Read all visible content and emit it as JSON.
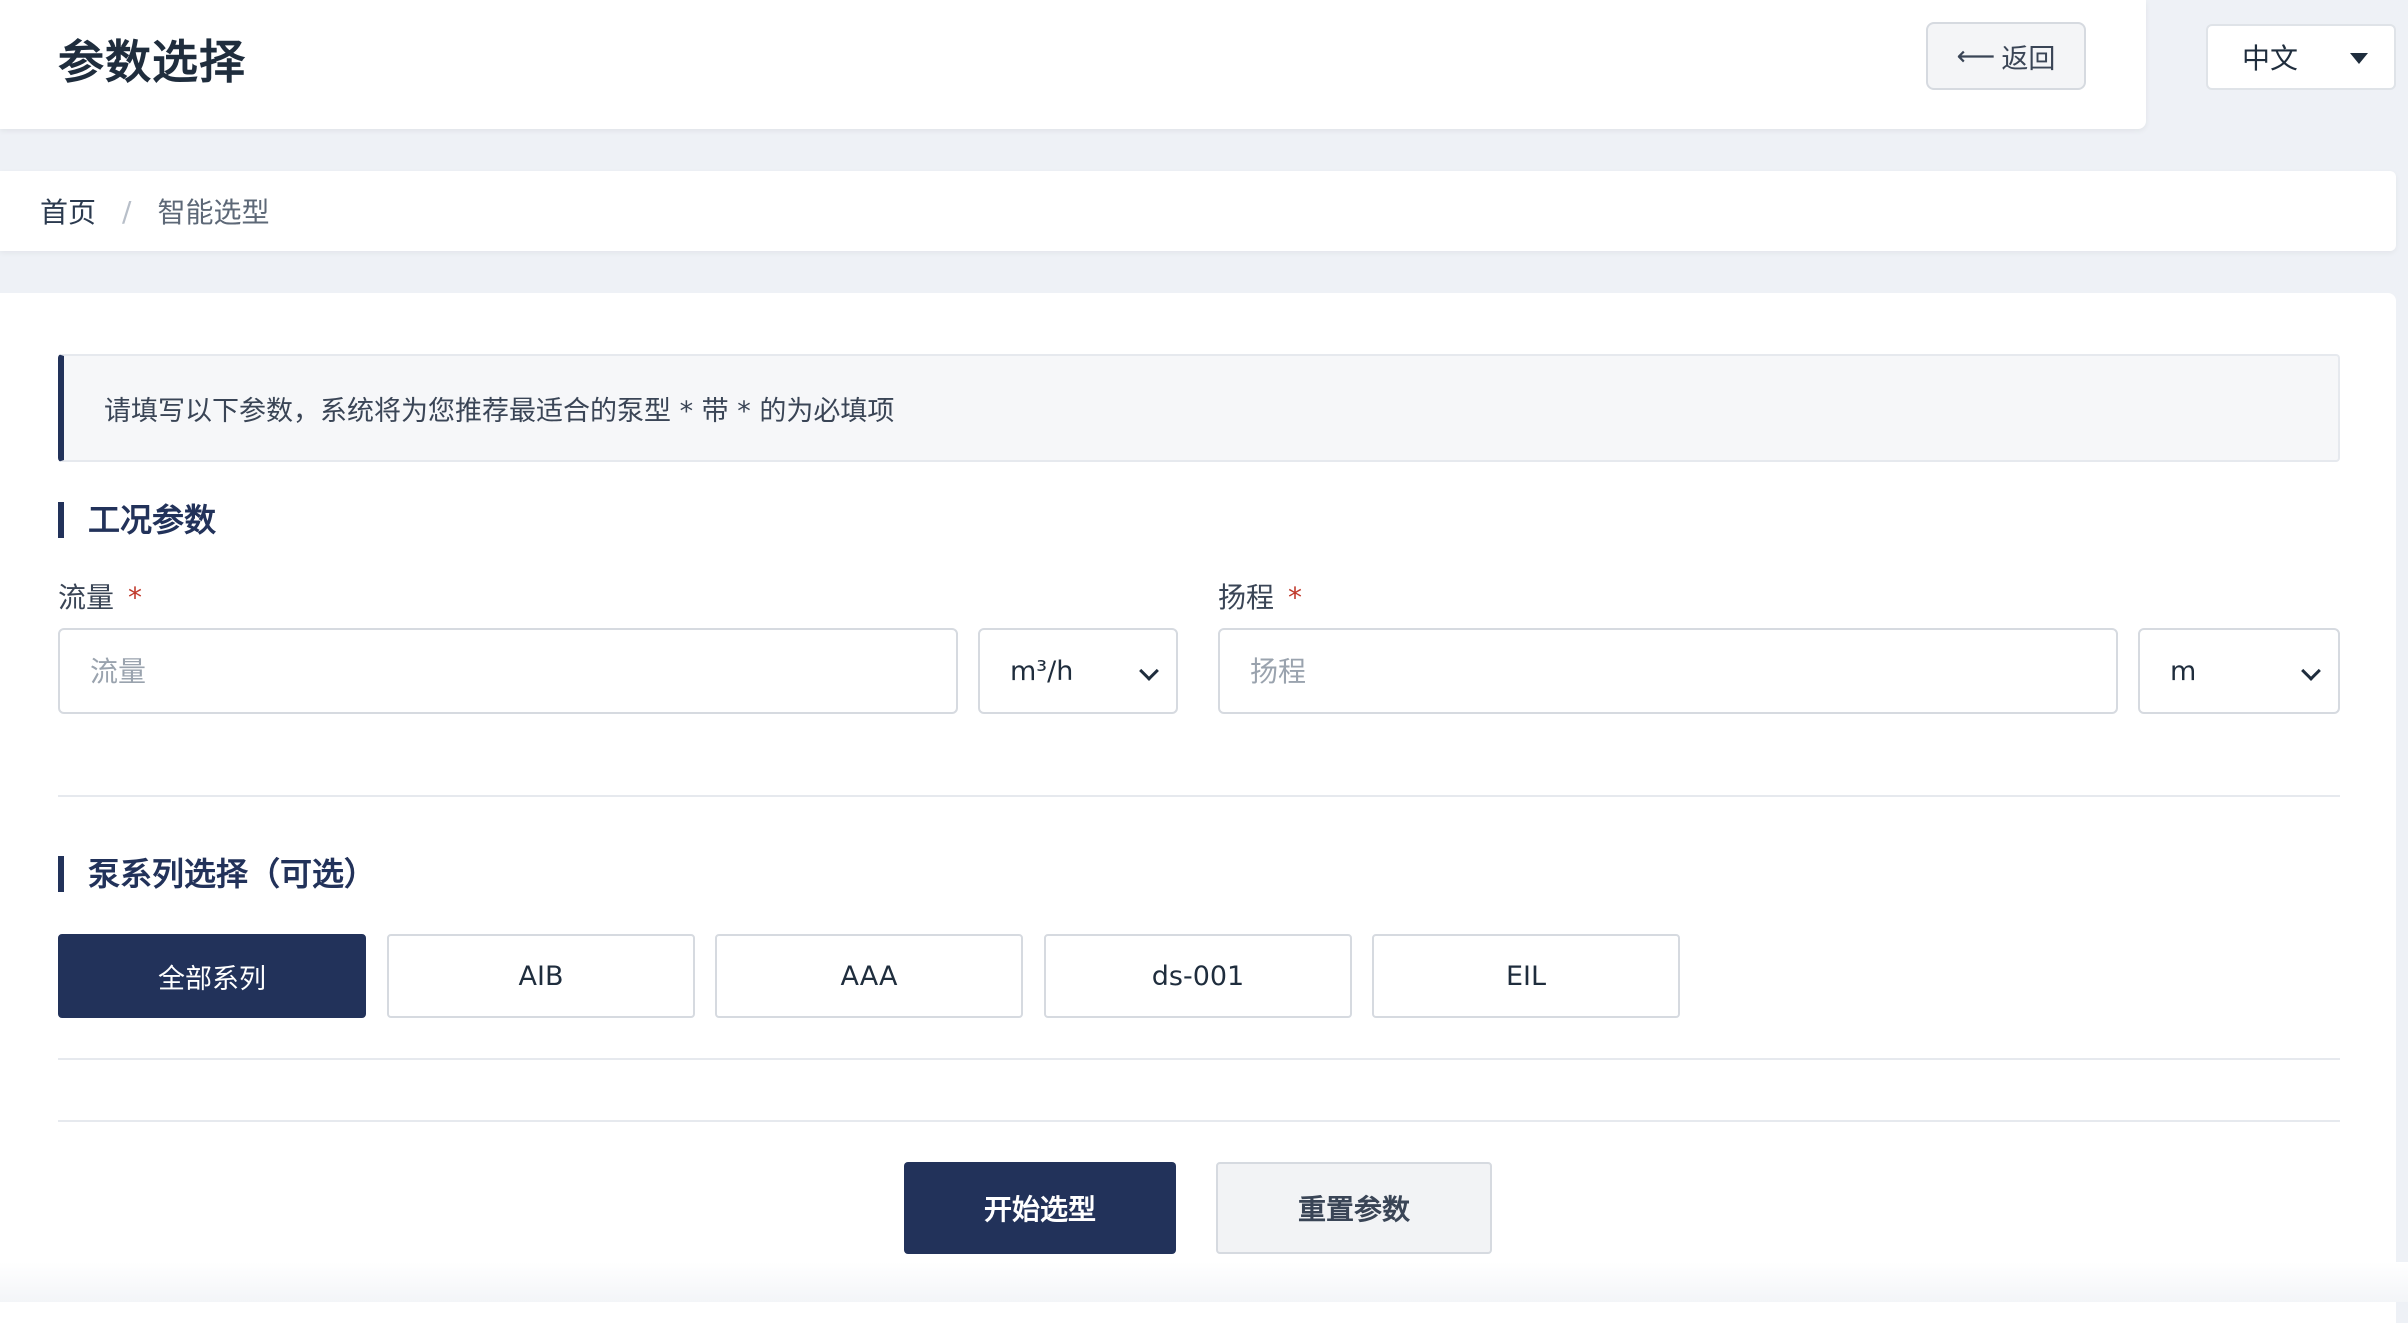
{
  "header": {
    "title": "参数选择",
    "back_arrow": "⟵",
    "back_label": "返回",
    "language": "中文"
  },
  "breadcrumb": {
    "home": "首页",
    "separator": "/",
    "current": "智能选型"
  },
  "notice": "请填写以下参数，系统将为您推荐最适合的泵型 * 带 * 的为必填项",
  "conditions": {
    "title": "工况参数",
    "flow": {
      "label": "流量",
      "required_mark": "*",
      "placeholder": "流量",
      "value": "",
      "unit": "m³/h"
    },
    "head": {
      "label": "扬程",
      "required_mark": "*",
      "placeholder": "扬程",
      "value": "",
      "unit": "m"
    }
  },
  "series": {
    "title": "泵系列选择（可选）",
    "options": [
      {
        "label": "全部系列",
        "selected": true
      },
      {
        "label": "AIB",
        "selected": false
      },
      {
        "label": "AAA",
        "selected": false
      },
      {
        "label": "ds-001",
        "selected": false
      },
      {
        "label": "EIL",
        "selected": false
      }
    ]
  },
  "actions": {
    "start_label": "开始选型",
    "reset_label": "重置参数"
  },
  "colors": {
    "primary": "#22325a",
    "required": "#c0392b",
    "background": "#eef1f6"
  }
}
